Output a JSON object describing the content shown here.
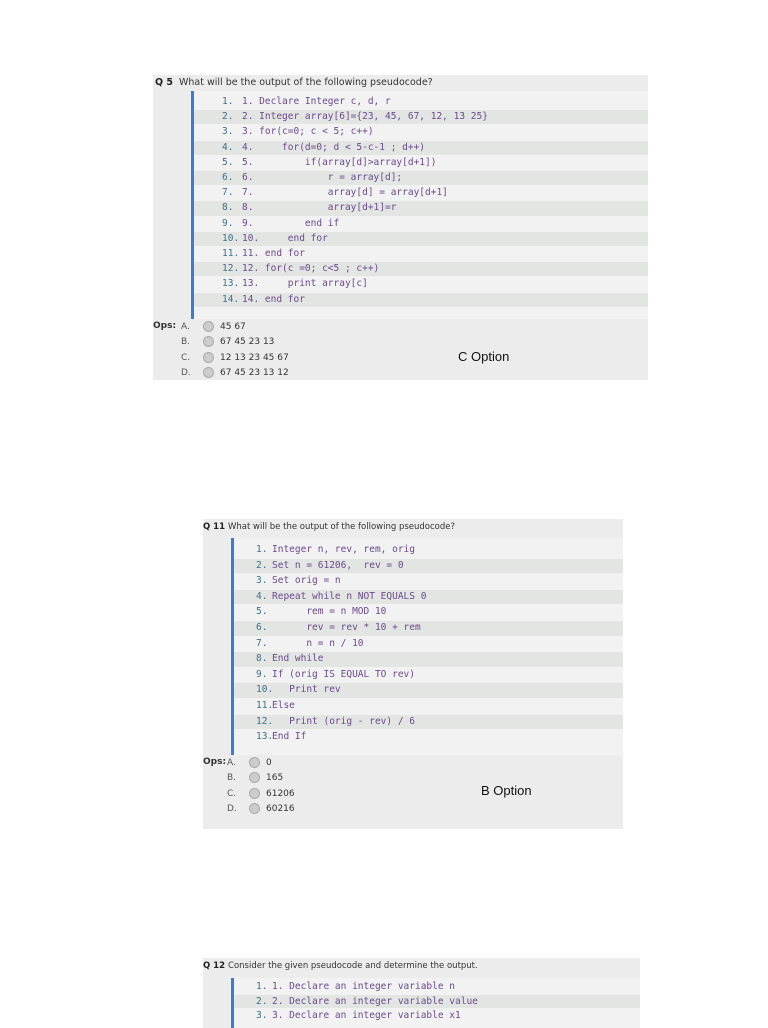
{
  "questions": [
    {
      "label": "Q 5",
      "text": "What will be the output of the following pseudocode?",
      "code": [
        "1. Declare Integer c, d, r",
        "2. Integer array[6]={23, 45, 67, 12, 13 25}",
        "3. for(c=0; c < 5; c++)",
        "4.     for(d=0; d < 5-c-1 ; d++)",
        "5.         if(array[d]>array[d+1])",
        "6.             r = array[d];",
        "7.             array[d] = array[d+1]",
        "8.             array[d+1]=r",
        "9.         end if",
        "10.     end for",
        "11. end for",
        "12. for(c =0; c<5 ; c++)",
        "13.     print array[c]",
        "14. end for"
      ],
      "ops_label": "Ops:",
      "options": [
        {
          "letter": "A.",
          "text": "45 67"
        },
        {
          "letter": "B.",
          "text": "67 45 23 13"
        },
        {
          "letter": "C.",
          "text": "12 13 23 45 67"
        },
        {
          "letter": "D.",
          "text": "67 45 23 13 12"
        }
      ],
      "answer": "C Option"
    },
    {
      "label": "Q 11",
      "text": "What will be the output of the following pseudocode?",
      "code": [
        "Integer n, rev, rem, orig",
        "Set n = 61206,  rev = 0",
        "Set orig = n",
        "Repeat while n NOT EQUALS 0",
        "      rem = n MOD 10",
        "      rev = rev * 10 + rem",
        "      n = n / 10",
        "End while",
        "If (orig IS EQUAL TO rev)",
        "   Print rev",
        "Else",
        "   Print (orig - rev) / 6",
        "End If"
      ],
      "ops_label": "Ops:",
      "options": [
        {
          "letter": "A.",
          "text": "0"
        },
        {
          "letter": "B.",
          "text": "165"
        },
        {
          "letter": "C.",
          "text": "61206"
        },
        {
          "letter": "D.",
          "text": "60216"
        }
      ],
      "answer": "B Option"
    },
    {
      "label": "Q 12",
      "text": "Consider the given pseudocode and determine the output.",
      "code": [
        "1. Declare an integer variable n",
        "2. Declare an integer variable value",
        "3. Declare an integer variable x1"
      ]
    }
  ]
}
